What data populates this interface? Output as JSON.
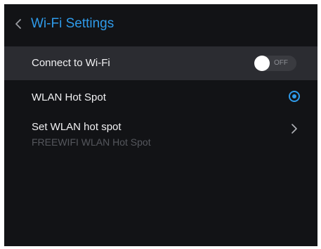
{
  "header": {
    "title": "Wi-Fi Settings",
    "back_icon": "chevron-left-icon"
  },
  "settings": {
    "connect_wifi": {
      "label": "Connect to Wi-Fi",
      "toggle_text": "OFF",
      "enabled": false
    },
    "wlan_hotspot": {
      "label": "WLAN Hot Spot",
      "selected": true
    },
    "set_wlan_hotspot": {
      "label": "Set WLAN hot spot",
      "value": "FREEWIFI WLAN Hot Spot",
      "icon": "chevron-right-icon"
    }
  },
  "colors": {
    "accent": "#2f9bea",
    "background": "#121316",
    "highlight_row": "#2b2c31"
  }
}
